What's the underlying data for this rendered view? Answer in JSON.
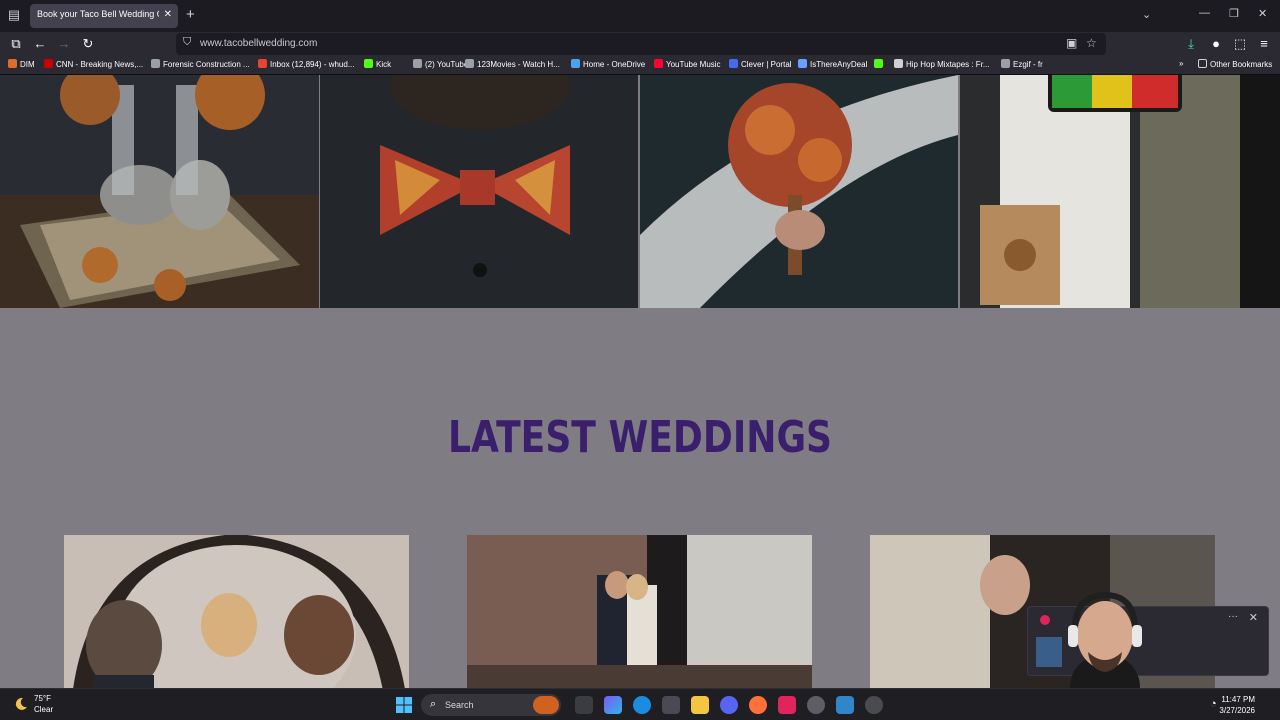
{
  "browser": {
    "tab_title": "Book your Taco Bell Wedding Online",
    "url": "www.tacobellwedding.com",
    "bookmarks": [
      {
        "label": "DIM",
        "color": "#e06c2c"
      },
      {
        "label": "CNN - Breaking News,...",
        "color": "#cc0000"
      },
      {
        "label": "Forensic Construction ...",
        "color": "#9aa0a6"
      },
      {
        "label": "Inbox (12,894) - whud...",
        "color": "#ea4335"
      },
      {
        "label": "Kick",
        "color": "#53fc18"
      },
      {
        "label": "(2) YouTube",
        "color": "#9aa0a6"
      },
      {
        "label": "123Movies - Watch H...",
        "color": "#9aa0a6"
      },
      {
        "label": "Home - OneDrive",
        "color": "#4aa3f2"
      },
      {
        "label": "YouTube Music",
        "color": "#ff0033"
      },
      {
        "label": "Clever | Portal",
        "color": "#436cf2"
      },
      {
        "label": "IsThereAnyDeal",
        "color": "#6aa0ff"
      },
      {
        "label": "",
        "color": "#53fc18"
      },
      {
        "label": "Hip Hop Mixtapes : Fr...",
        "color": "#cfcfd8"
      },
      {
        "label": "Ezgif - fr",
        "color": "#9aa0a6"
      }
    ],
    "other_bookmarks": "Other Bookmarks"
  },
  "page": {
    "section_title": "LATEST WEDDINGS"
  },
  "taskbar": {
    "weather_temp": "75°F",
    "weather_cond": "Clear",
    "search_placeholder": "Search",
    "time": "11:47 PM",
    "date": "3/27/2026"
  }
}
